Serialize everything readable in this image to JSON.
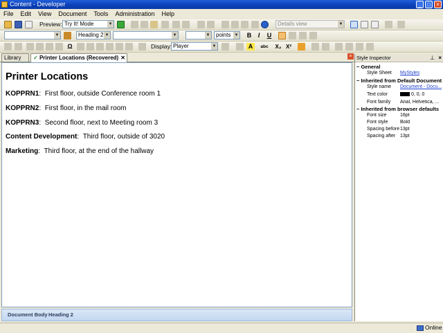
{
  "window": {
    "title": "Content - Developer"
  },
  "menu": [
    "File",
    "Edit",
    "View",
    "Document",
    "Tools",
    "Administration",
    "Help"
  ],
  "toolbar1": {
    "preview_label": "Preview:",
    "preview_mode": "Try It! Mode",
    "view_mode": "Details view"
  },
  "toolbar2": {
    "style_value": "Heading 2",
    "unit_value": "points",
    "bold": "B",
    "italic": "I",
    "underline": "U"
  },
  "toolbar3": {
    "omega": "Ω",
    "display_label": "Display:",
    "display_value": "Player",
    "highlight": "A",
    "abc": "abc",
    "subscript": "X₂",
    "superscript": "X²"
  },
  "tabs": {
    "library": "Library",
    "active": "Printer Locations (Recovered)"
  },
  "document": {
    "heading": "Printer Locations",
    "entries": [
      {
        "name": "KOPPRN1",
        "location": "First floor, outside Conference room 1"
      },
      {
        "name": "KOPPRN2",
        "location": "First floor, in the mail room"
      },
      {
        "name": "KOPPRN3",
        "location": "Second floor, next to Meeting room 3"
      },
      {
        "name": "Content Development",
        "location": "Third floor, outside of 3020"
      },
      {
        "name": "Marketing",
        "location": "Third floor, at the end of the hallway"
      }
    ],
    "separator": ":"
  },
  "breadcrumb": [
    "Document Body",
    "Heading 2"
  ],
  "inspector": {
    "title": "Style Inspector",
    "section_general": "General",
    "style_sheet_label": "Style Sheet",
    "style_sheet_value": "MyStyles",
    "section_inherited_doc": "Inherited from Default Document",
    "style_name_label": "Style name",
    "style_name_value": "Document - Docu...",
    "text_color_label": "Text color",
    "text_color_value": "0, 0, 0",
    "font_family_label": "Font family",
    "font_family_value": "Arial, Helvetica, ...",
    "section_browser": "Inherited from browser defaults",
    "font_size_label": "Font size",
    "font_size_value": "16pt",
    "font_style_label": "Font style",
    "font_style_value": "Bold",
    "spacing_before_label": "Spacing before",
    "spacing_before_value": "13pt",
    "spacing_after_label": "Spacing after",
    "spacing_after_value": "13pt"
  },
  "status": {
    "online": "Online"
  },
  "colors": {
    "title_bar": "#0a3fb8",
    "link": "#1f3fcf",
    "accent": "#316ac5"
  }
}
